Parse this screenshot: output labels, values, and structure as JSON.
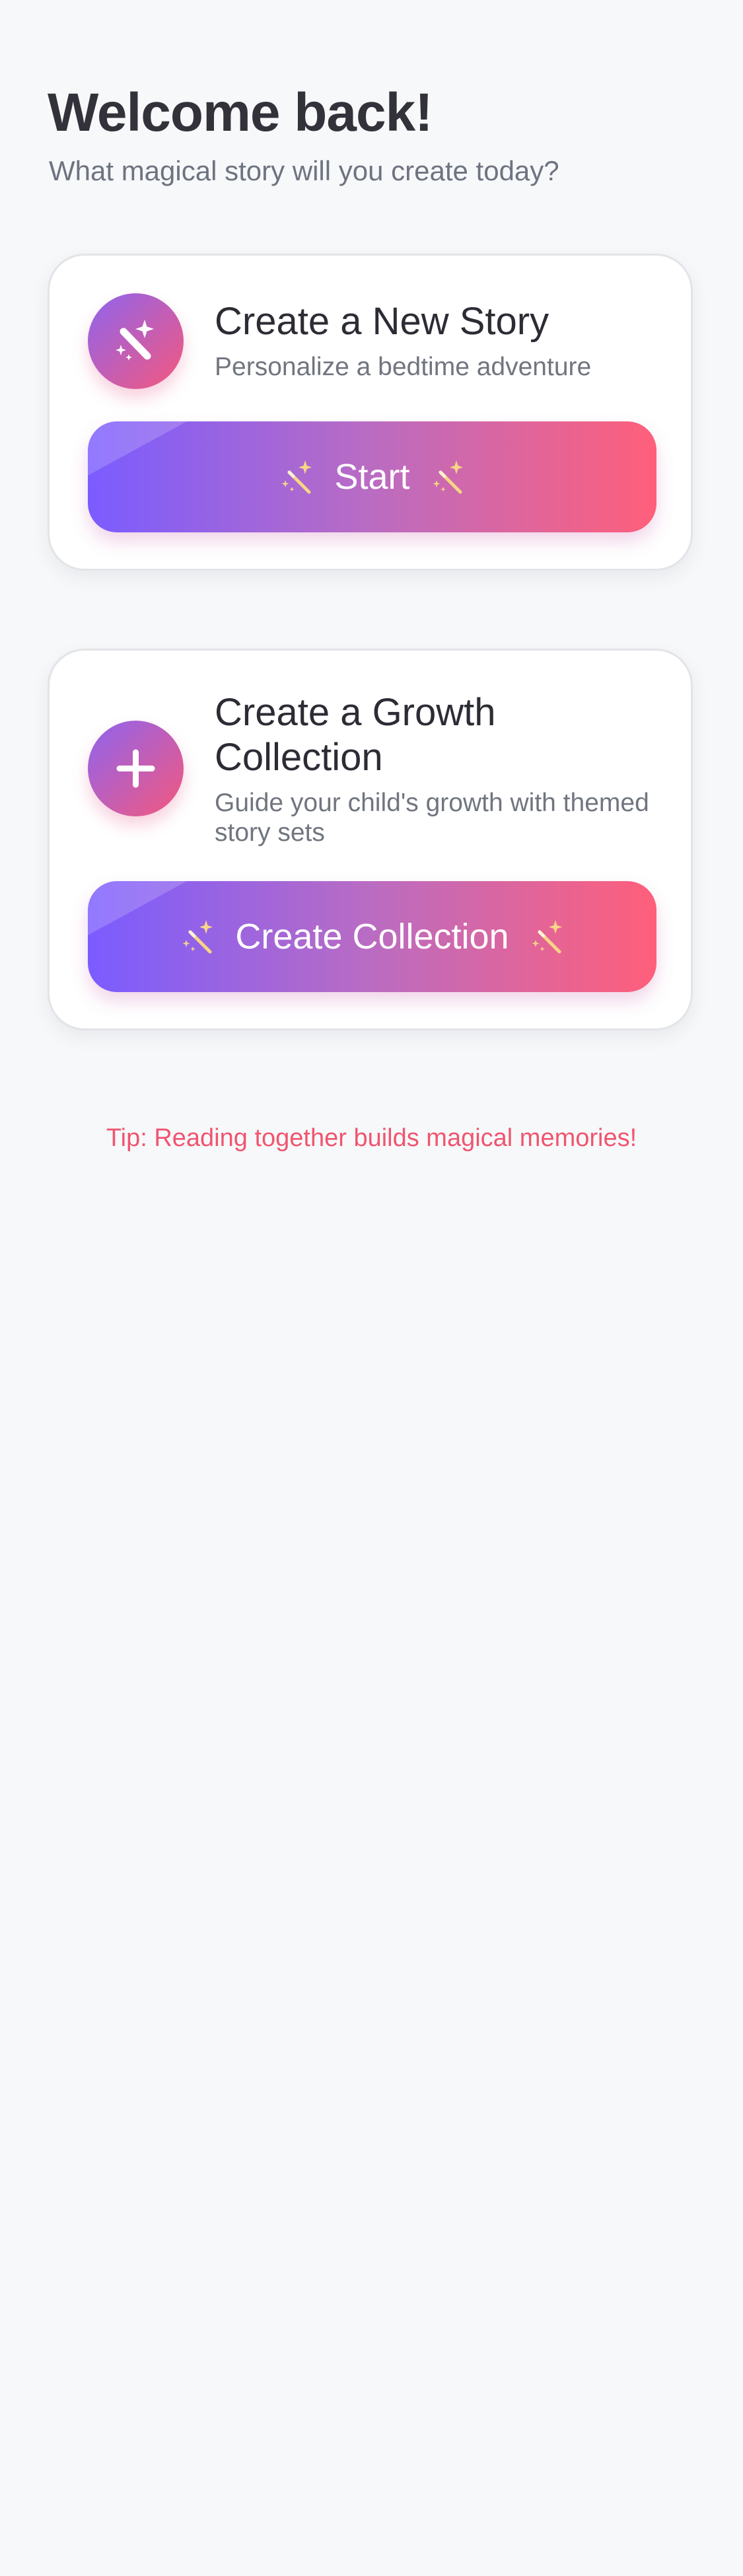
{
  "header": {
    "greeting": "Welcome back!",
    "subtitle": "What magical story will you create today?"
  },
  "cards": {
    "new_story": {
      "icon": "magic-wand-icon",
      "title": "Create a New Story",
      "description": "Personalize a bedtime adventure",
      "button_label": "Start"
    },
    "growth_collection": {
      "icon": "plus-icon",
      "title": "Create a Growth Collection",
      "description": "Guide your child's growth with themed story sets",
      "button_label": "Create Collection"
    }
  },
  "tip": "Tip: Reading together builds magical memories!",
  "colors": {
    "background": "#f7f8fa",
    "gradient_start": "#7a5cff",
    "gradient_end": "#ff5f7a",
    "tip_text": "#f0556f",
    "wand_sparkle": "#f6d27a"
  }
}
